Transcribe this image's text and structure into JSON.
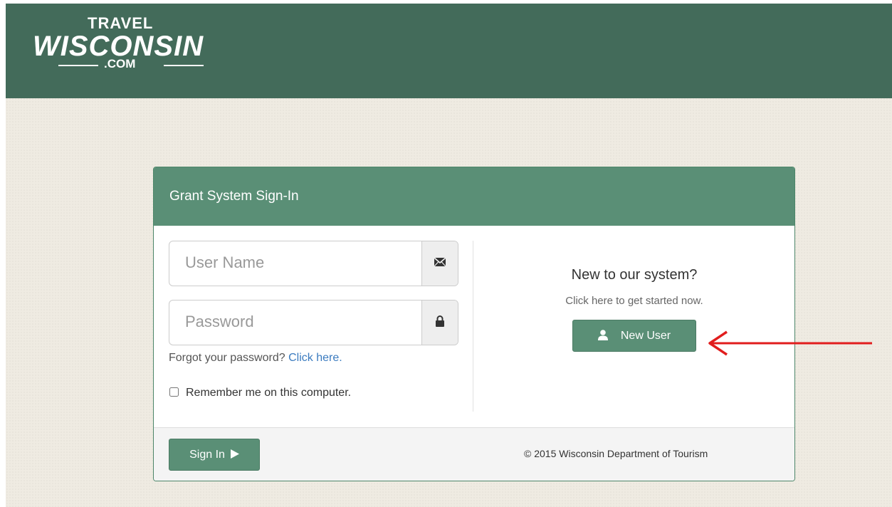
{
  "header": {
    "logo": {
      "line1": "TRAVEL",
      "line2": "WISCONSIN",
      "line3": ".COM"
    },
    "background_color": "#436b5a"
  },
  "panel": {
    "title": "Grant System Sign-In",
    "username": {
      "placeholder": "User Name",
      "value": "",
      "icon": "envelope-icon"
    },
    "password": {
      "placeholder": "Password",
      "value": "",
      "icon": "lock-icon"
    },
    "forgot_text": "Forgot your password?",
    "forgot_link": "Click here.",
    "remember_label": "Remember me on this computer.",
    "remember_checked": false,
    "new_user": {
      "title": "New to our system?",
      "subtitle": "Click here to get started now.",
      "button_label": "New User",
      "button_icon": "user-icon"
    },
    "footer": {
      "signin_label": "Sign In",
      "signin_icon": "play-icon",
      "copyright": "© 2015 Wisconsin Department of Tourism"
    }
  },
  "colors": {
    "accent": "#5a8f76",
    "header": "#436b5a",
    "link": "#3b7bbf",
    "annotation_arrow": "#e11d1d",
    "page_background": "#efebe2"
  }
}
